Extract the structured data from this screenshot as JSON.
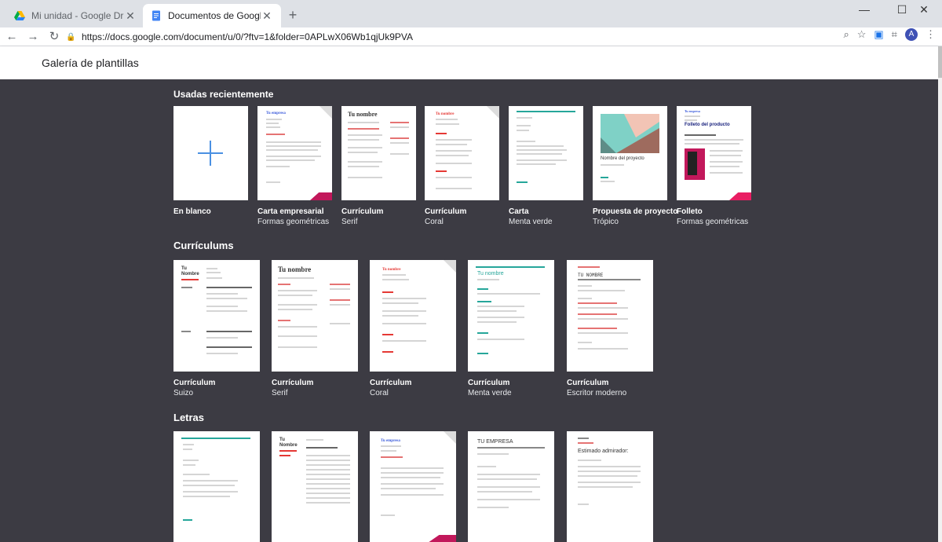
{
  "browser": {
    "tabs": [
      {
        "title": "Mi unidad - Google Drive",
        "active": false
      },
      {
        "title": "Documentos de Google",
        "active": true
      }
    ],
    "url": "https://docs.google.com/document/u/0/?ftv=1&folder=0APLwX06Wb1qjUk9PVA",
    "profile_initial": "A"
  },
  "page": {
    "title": "Galería de plantillas"
  },
  "sections": [
    {
      "title": "Usadas recientemente",
      "templates": [
        {
          "name": "En blanco",
          "sub": "",
          "thumb_head": ""
        },
        {
          "name": "Carta empresarial",
          "sub": "Formas geométricas",
          "thumb_head": "Tu empresa"
        },
        {
          "name": "Currículum",
          "sub": "Serif",
          "thumb_head": "Tu nombre"
        },
        {
          "name": "Currículum",
          "sub": "Coral",
          "thumb_head": "Tu nombre"
        },
        {
          "name": "Carta",
          "sub": "Menta verde",
          "thumb_head": ""
        },
        {
          "name": "Propuesta de proyecto",
          "sub": "Trópico",
          "thumb_head": "Nombre del proyecto"
        },
        {
          "name": "Folleto",
          "sub": "Formas geométricas",
          "thumb_head": "Folleto del producto"
        }
      ]
    },
    {
      "title": "Currículums",
      "templates": [
        {
          "name": "Currículum",
          "sub": "Suizo",
          "thumb_head": "Tu Nombre"
        },
        {
          "name": "Currículum",
          "sub": "Serif",
          "thumb_head": "Tu nombre"
        },
        {
          "name": "Currículum",
          "sub": "Coral",
          "thumb_head": "Tu nombre"
        },
        {
          "name": "Currículum",
          "sub": "Menta verde",
          "thumb_head": "Tu nombre"
        },
        {
          "name": "Currículum",
          "sub": "Escritor moderno",
          "thumb_head": "TU NOMBRE"
        }
      ]
    },
    {
      "title": "Letras",
      "templates": [
        {
          "thumb_head": ""
        },
        {
          "thumb_head": "Tu Nombre"
        },
        {
          "thumb_head": "Tu empresa"
        },
        {
          "thumb_head": "TU EMPRESA"
        },
        {
          "thumb_head": "Estimado admirador:"
        }
      ]
    }
  ],
  "colors": {
    "gallery_bg": "#3c3b43",
    "accent_pink": "#c2185b",
    "accent_mint": "#26a69a",
    "accent_coral": "#e53935",
    "blank_plus": "#4a90e2"
  }
}
